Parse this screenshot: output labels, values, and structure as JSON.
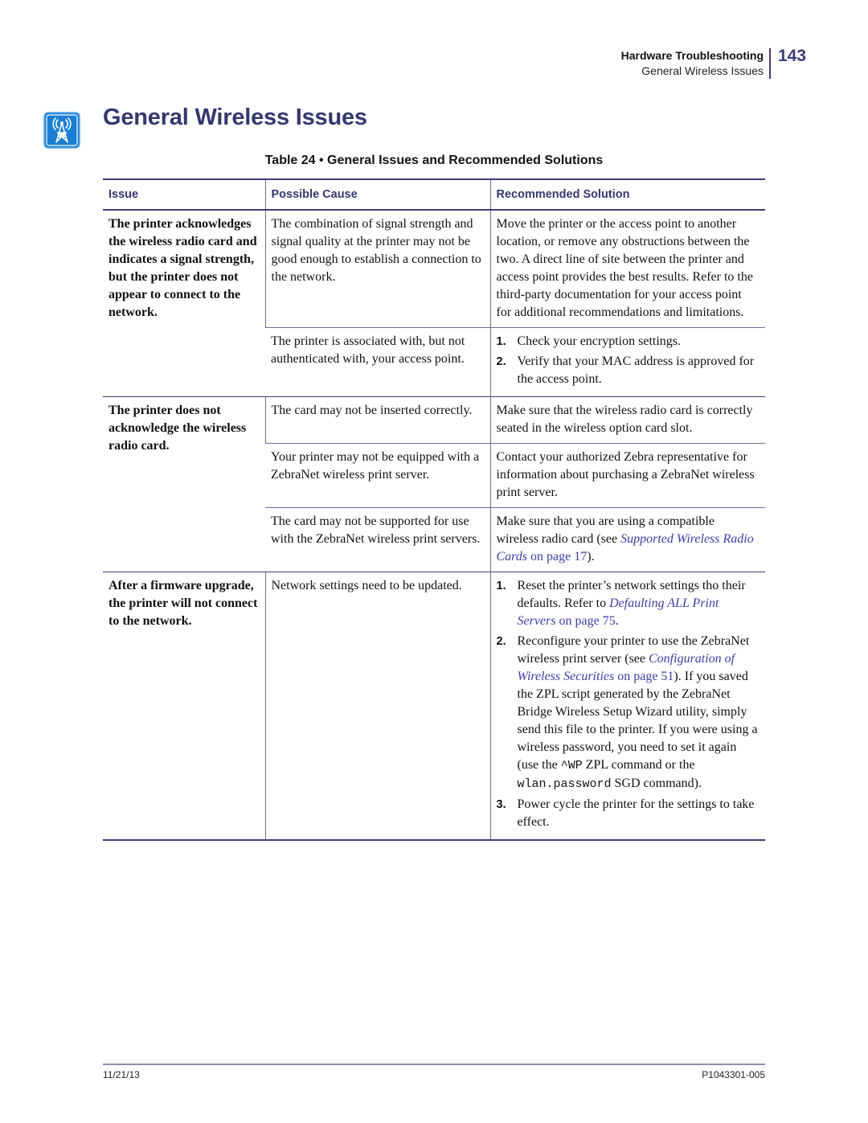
{
  "running_head": {
    "section": "Hardware Troubleshooting",
    "subsection": "General Wireless Issues",
    "page_number": "143"
  },
  "section": {
    "icon": "wireless-antenna-icon",
    "title": "General Wireless Issues",
    "accent_color": "#34386e",
    "icon_color": "#1a7fd4"
  },
  "table": {
    "caption": "Table 24 • General Issues and Recommended Solutions",
    "headers": [
      "Issue",
      "Possible Cause",
      "Recommended Solution"
    ],
    "rows": [
      {
        "issue": "The printer acknowledges the wireless radio card and indicates a signal strength, but the printer does not appear to connect to the network.",
        "cause": "The combination of signal strength and signal quality at the printer may not be good enough to establish a connection to the network.",
        "solution": "Move the printer or the access point to another location, or remove any obstructions between the two. A direct line of site between the printer and access point provides the best results. Refer to the third-party documentation for your access point for additional recommendations and limitations."
      },
      {
        "issue": "",
        "cause": "The printer is associated with, but not authenticated with, your access point.",
        "steps": [
          {
            "num": "1.",
            "text": "Check your encryption settings."
          },
          {
            "num": "2.",
            "text": "Verify that your MAC address is approved for the access point."
          }
        ]
      },
      {
        "issue": "The printer does not acknowledge the wireless radio card.",
        "cause": "The card may not be inserted correctly.",
        "solution": "Make sure that the wireless radio card is correctly seated in the wireless option card slot."
      },
      {
        "issue": "",
        "cause": "Your printer may not be equipped with a ZebraNet wireless print server.",
        "solution": "Contact your authorized Zebra representative for information about purchasing a ZebraNet wireless print server."
      },
      {
        "issue": "",
        "cause": "The card may not be supported for use with the ZebraNet wireless print servers.",
        "solution_pre": "Make sure that you are using a compatible wireless radio card (see ",
        "solution_link": "Supported Wireless Radio Cards",
        "solution_link_page": " on page 17",
        "solution_post": ")."
      },
      {
        "issue": "After a firmware upgrade, the printer will not connect to the network.",
        "cause": "Network settings need to be updated.",
        "steps": [
          {
            "num": "1.",
            "pre": "Reset the printer’s network settings tho their defaults. Refer to ",
            "link": "Defaulting ALL Print Servers",
            "link_page": " on page 75",
            "post": "."
          },
          {
            "num": "2.",
            "pre": "Reconfigure your printer to use the ZebraNet wireless print server (see ",
            "link": "Configuration of Wireless Securities",
            "link_page": " on page 51",
            "post_a": "). If you saved the ZPL script generated by the ZebraNet Bridge Wireless Setup Wizard utility, simply send this file to the printer. If you were using a wireless password, you need to set it again (use the ",
            "code_a": "^WP",
            "post_b": " ZPL command or the ",
            "code_b": "wlan.password",
            "post_c": " SGD command)."
          },
          {
            "num": "3.",
            "text": "Power cycle the printer for the settings to take effect."
          }
        ]
      }
    ]
  },
  "footer": {
    "date": "11/21/13",
    "doc_number": "P1043301-005"
  }
}
